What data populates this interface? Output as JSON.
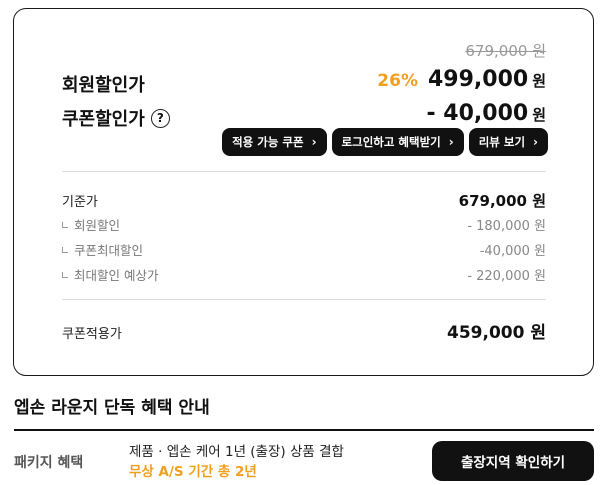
{
  "pricing": {
    "original_price": "679,000 원",
    "member_label": "회원할인가",
    "member_discount_pct": "26%",
    "member_price": "499,000",
    "member_price_unit": "원",
    "coupon_label": "쿠폰할인가",
    "help_icon_text": "?",
    "coupon_price": "- 40,000",
    "coupon_price_unit": "원"
  },
  "buttons": {
    "coupons": "적용 가능 쿠폰",
    "login_benefits": "로그인하고 혜택받기",
    "reviews": "리뷰 보기",
    "chevron": "›"
  },
  "breakdown": {
    "base": {
      "label": "기준가",
      "value": "679,000 원"
    },
    "member": {
      "label": "회원할인",
      "value": "- 180,000 원"
    },
    "coupon_max": {
      "label": "쿠폰최대할인",
      "value": "-40,000 원"
    },
    "max_estimated": {
      "label": "최대할인 예상가",
      "value": "- 220,000 원"
    },
    "final": {
      "label": "쿠폰적용가",
      "value": "459,000 원"
    }
  },
  "benefits": {
    "title": "엡손 라운지 단독 혜택 안내",
    "package_label": "패키지 혜택",
    "package_desc": "제품 · 엡손 케어 1년 (출장) 상품 결합",
    "package_highlight": "무상 A/S 기간 총 2년",
    "cta_label": "출장지역 확인하기"
  },
  "colors": {
    "accent": "#f0a020",
    "dark": "#111111"
  }
}
